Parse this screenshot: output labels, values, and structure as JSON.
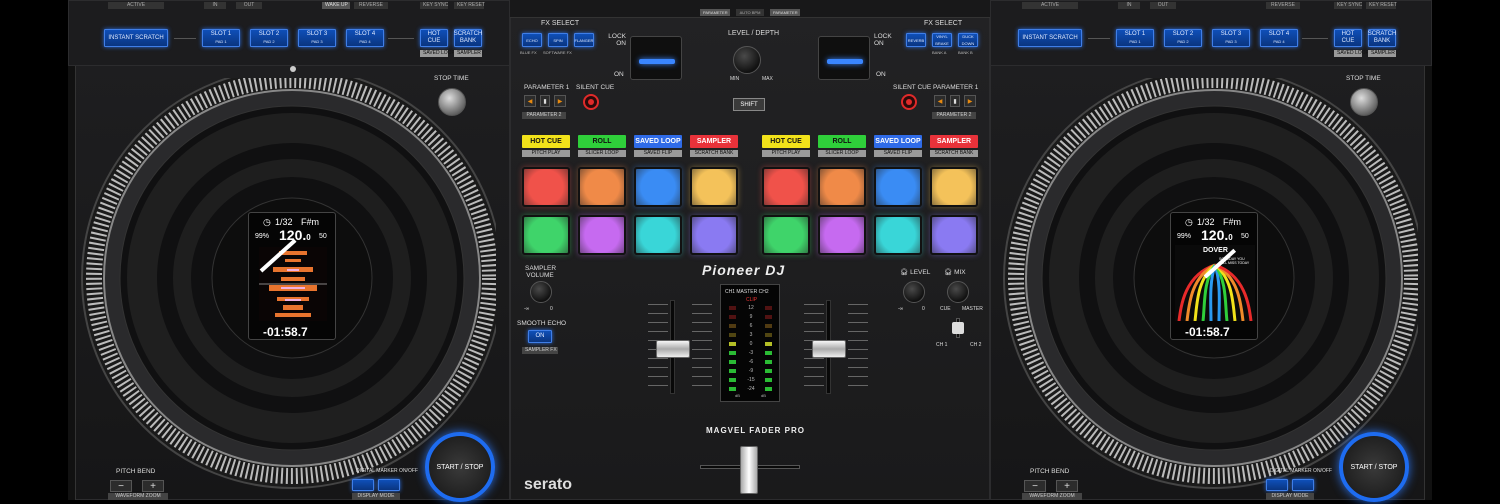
{
  "left_deck": {
    "top_labels": [
      "ACTIVE",
      "IN",
      "OUT",
      "WAKE UP",
      "REVERSE",
      "KEY SYNC",
      "KEY RESET"
    ],
    "instant_scratch": "INSTANT SCRATCH",
    "slots": [
      {
        "label": "SLOT 1",
        "sub": "PAD 1"
      },
      {
        "label": "SLOT 2",
        "sub": "PAD 2"
      },
      {
        "label": "SLOT 3",
        "sub": "PAD 3"
      },
      {
        "label": "SLOT 4",
        "sub": "PAD 4"
      }
    ],
    "hot_cue": "HOT CUE",
    "scratch_bank": "SCRATCH BANK",
    "hot_cue_sub": "SAVED LOOP",
    "scratch_bank_sub": "SAMPLER",
    "stop_time": "STOP TIME",
    "screen": {
      "beat": "1/32",
      "key": "F#m",
      "bpm": "120.",
      "bpm_dec": "0",
      "pitch_left": "99%",
      "pitch_right": "50",
      "time": "-01:58.7"
    },
    "pitch_bend": "PITCH BEND",
    "minus": "−",
    "plus": "+",
    "waveform_zoom": "WAVEFORM ZOOM",
    "digital_marker": "DIGITAL MARKER ON/OFF",
    "display_mode": "DISPLAY MODE",
    "start_stop": "START / STOP"
  },
  "right_deck": {
    "top_labels": [
      "ACTIVE",
      "IN",
      "OUT",
      "REVERSE",
      "KEY SYNC",
      "KEY RESET"
    ],
    "instant_scratch": "INSTANT SCRATCH",
    "slots": [
      {
        "label": "SLOT 1",
        "sub": "PAD 1"
      },
      {
        "label": "SLOT 2",
        "sub": "PAD 2"
      },
      {
        "label": "SLOT 3",
        "sub": "PAD 3"
      },
      {
        "label": "SLOT 4",
        "sub": "PAD 4"
      }
    ],
    "hot_cue": "HOT CUE",
    "scratch_bank": "SCRATCH BANK",
    "hot_cue_sub": "SAVED LOOP",
    "scratch_bank_sub": "SAMPLER",
    "stop_time": "STOP TIME",
    "screen": {
      "beat": "1/32",
      "key": "F#m",
      "bpm": "120.",
      "bpm_dec": "0",
      "pitch_left": "99%",
      "pitch_right": "50",
      "time": "-01:58.7",
      "art_title": "DOVER",
      "art_sub": "SOMEDAY YOU WILL MISS TODAY"
    },
    "pitch_bend": "PITCH BEND",
    "minus": "−",
    "plus": "+",
    "waveform_zoom": "WAVEFORM ZOOM",
    "digital_marker": "DIGITAL MARKER ON/OFF",
    "display_mode": "DISPLAY MODE",
    "start_stop": "START / STOP"
  },
  "mixer": {
    "top_labels": [
      "PARAMETER",
      "AUTO BPM",
      "PARAMETER"
    ],
    "fx_select_left": "FX SELECT",
    "fx_select_right": "FX SELECT",
    "fx_left_buttons": [
      {
        "label": "ECHO",
        "sub": "BLUE FX"
      },
      {
        "label": "SPIN",
        "sub": "SOFTWARE FX"
      },
      {
        "label": "FLANGER",
        "sub": ""
      }
    ],
    "fx_right_buttons": [
      {
        "label": "REVERB",
        "sub": "BANK A"
      },
      {
        "label": "VINYL BRAKE",
        "sub": ""
      },
      {
        "label": "DUCK DOWN",
        "sub": "BANK B"
      }
    ],
    "lock_on": "LOCK ON",
    "on": "ON",
    "level_depth": "LEVEL / DEPTH",
    "min": "MIN",
    "max": "MAX",
    "shift": "SHIFT",
    "parameter1": "PARAMETER 1",
    "parameter2": "PARAMETER 2",
    "silent_cue": "SILENT CUE",
    "pad_modes_left": [
      {
        "label": "HOT CUE",
        "sub": "PITCH PLAY",
        "color": "#f2e21a"
      },
      {
        "label": "ROLL",
        "sub": "SLICER LOOP",
        "color": "#2fcf3a"
      },
      {
        "label": "SAVED LOOP",
        "sub": "SAVED FLIP",
        "color": "#2f6be8"
      },
      {
        "label": "SAMPLER",
        "sub": "SCRATCH BANK",
        "color": "#e8323a"
      }
    ],
    "pad_modes_right": [
      {
        "label": "HOT CUE",
        "sub": "PITCH PLAY",
        "color": "#f2e21a"
      },
      {
        "label": "ROLL",
        "sub": "SLICER LOOP",
        "color": "#2fcf3a"
      },
      {
        "label": "SAVED LOOP",
        "sub": "SAVED FLIP",
        "color": "#2f6be8"
      },
      {
        "label": "SAMPLER",
        "sub": "SCRATCH BANK",
        "color": "#e8323a"
      }
    ],
    "pad_colors_row1": [
      "#f0524a",
      "#f08a48",
      "#3a8cf4",
      "#f4c25a"
    ],
    "pad_colors_row2": [
      "#3fd46a",
      "#c66af0",
      "#39d6d8",
      "#8a7af2"
    ],
    "brand": "Pioneer DJ",
    "sampler_volume": "SAMPLER VOLUME",
    "minus_inf": "-∞",
    "zero": "0",
    "smooth_echo": "SMOOTH ECHO",
    "smooth_echo_btn": "ON",
    "sampler_fx": "SAMPLER FX",
    "level": "LEVEL",
    "mix": "MIX",
    "cue": "CUE",
    "master": "MASTER",
    "ch1": "CH 1",
    "ch2": "CH 2",
    "meter_header": "CH1  MASTER  CH2",
    "clip": "CLIP",
    "meter_scale": [
      "12",
      "9",
      "6",
      "3",
      "0",
      "-3",
      "-6",
      "-9",
      "-15",
      "-24"
    ],
    "db": "dB",
    "magvel": "MAGVEL FADER PRO",
    "serato": "serato"
  }
}
